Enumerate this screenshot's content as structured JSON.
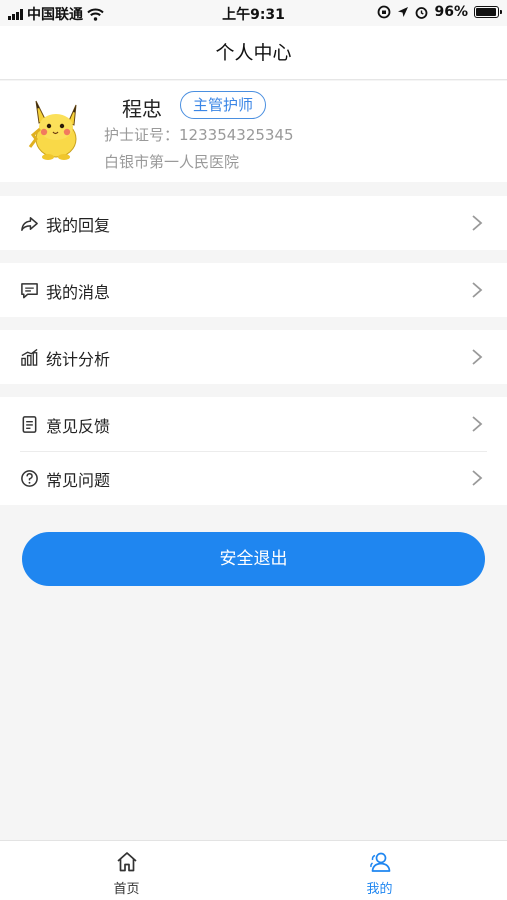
{
  "status_bar": {
    "carrier": "中国联通",
    "time": "上午9:31",
    "battery_text": "96%",
    "battery_level": 0.96
  },
  "header": {
    "title": "个人中心"
  },
  "profile": {
    "name": "程忠",
    "role_badge": "主管护师",
    "cert_label": "护士证号：",
    "cert_number": "123354325345",
    "hospital": "白银市第一人民医院"
  },
  "menu": {
    "reply": {
      "label": "我的回复",
      "icon": "share-icon"
    },
    "messages": {
      "label": "我的消息",
      "icon": "message-icon"
    },
    "stats": {
      "label": "统计分析",
      "icon": "chart-icon"
    },
    "feedback": {
      "label": "意见反馈",
      "icon": "document-icon"
    },
    "faq": {
      "label": "常见问题",
      "icon": "question-icon"
    }
  },
  "logout": {
    "label": "安全退出"
  },
  "tabbar": {
    "home": {
      "label": "首页",
      "icon": "home-icon"
    },
    "mine": {
      "label": "我的",
      "icon": "user-icon"
    }
  },
  "colors": {
    "accent": "#1f86f0",
    "badge": "#3b86e6",
    "background": "#f5f5f5",
    "active_tab": "#1f86f0",
    "inactive_tab": "#333333"
  }
}
